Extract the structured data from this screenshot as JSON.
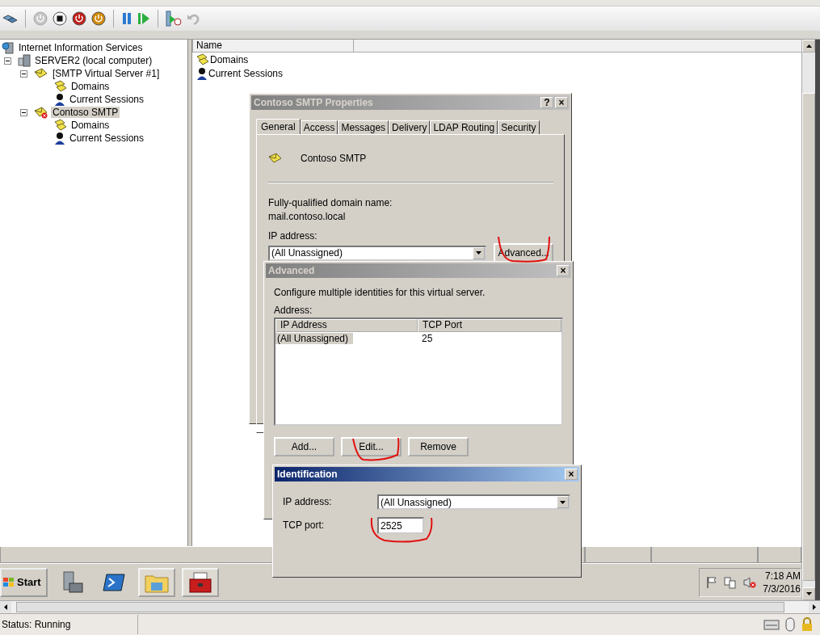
{
  "host_toolbar": [
    {
      "kind": "ctrl-alt-del"
    },
    {
      "kind": "sep"
    },
    {
      "kind": "start",
      "disabled": true
    },
    {
      "kind": "turn-off",
      "disabled": false
    },
    {
      "kind": "shut-down",
      "disabled": false
    },
    {
      "kind": "save",
      "disabled": false
    },
    {
      "kind": "sep"
    },
    {
      "kind": "pause"
    },
    {
      "kind": "resume"
    },
    {
      "kind": "sep"
    },
    {
      "kind": "snapshot"
    },
    {
      "kind": "revert",
      "disabled": true
    }
  ],
  "tree": [
    {
      "label": "Internet Information Services",
      "kind": "iis",
      "selected": false,
      "children": [
        {
          "label": "SERVER2 (local computer)",
          "kind": "server",
          "expanded": true,
          "selected": false,
          "children": [
            {
              "label": "[SMTP Virtual Server #1]",
              "kind": "smtp",
              "expanded": true,
              "selected": false,
              "children": [
                {
                  "label": "Domains",
                  "kind": "domains",
                  "selected": false
                },
                {
                  "label": "Current Sessions",
                  "kind": "sessions",
                  "selected": false
                }
              ]
            },
            {
              "label": "Contoso SMTP",
              "kind": "smtp-stopped",
              "expanded": true,
              "selected": true,
              "children": [
                {
                  "label": "Domains",
                  "kind": "domains",
                  "selected": false
                },
                {
                  "label": "Current Sessions",
                  "kind": "sessions",
                  "selected": false
                }
              ]
            }
          ]
        }
      ]
    }
  ],
  "list": {
    "columns": [
      "Name"
    ],
    "rows": [
      {
        "name": "Domains",
        "kind": "domains"
      },
      {
        "name": "Current Sessions",
        "kind": "sessions"
      }
    ]
  },
  "properties": {
    "title": "Contoso SMTP Properties",
    "help": "?",
    "close": "×",
    "tabs": [
      {
        "label": "General",
        "selected": true
      },
      {
        "label": "Access",
        "selected": false
      },
      {
        "label": "Messages",
        "selected": false
      },
      {
        "label": "Delivery",
        "selected": false
      },
      {
        "label": "LDAP Routing",
        "selected": false
      },
      {
        "label": "Security",
        "selected": false
      }
    ],
    "server_name": "Contoso SMTP",
    "fqdn_label": "Fully-qualified domain name:",
    "fqdn_value": "mail.contoso.local",
    "ip_label": "IP address:",
    "ip_value": "(All Unassigned)",
    "advanced_button": "Advanced..."
  },
  "advanced": {
    "title": "Advanced",
    "close": "×",
    "description": "Configure multiple identities for this virtual server.",
    "address_label": "Address:",
    "columns": [
      "IP Address",
      "TCP Port"
    ],
    "rows": [
      {
        "ip": "(All Unassigned)",
        "port": "25",
        "selected": true
      }
    ],
    "buttons": [
      "Add...",
      "Edit...",
      "Remove"
    ]
  },
  "identification": {
    "title": "Identification",
    "close": "×",
    "ip_label": "IP address:",
    "ip_value": "(All Unassigned)",
    "port_label": "TCP port:",
    "port_value": "2525"
  },
  "taskbar": {
    "start": "Start",
    "apps": [
      {
        "kind": "server-manager",
        "open": false
      },
      {
        "kind": "powershell",
        "open": false
      },
      {
        "kind": "explorer",
        "open": true
      },
      {
        "kind": "toolbox",
        "open": true
      }
    ],
    "time": "7:18 AM",
    "date": "7/3/2016"
  },
  "host_status": "Status: Running"
}
